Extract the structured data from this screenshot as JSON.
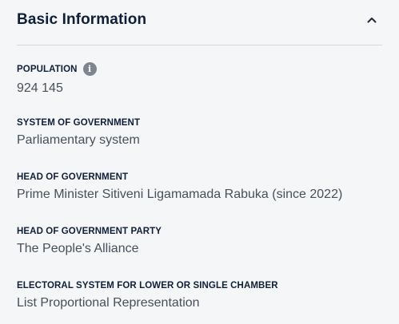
{
  "section": {
    "title": "Basic Information",
    "toggle_icon": "chevron-up-icon"
  },
  "fields": [
    {
      "label": "POPULATION",
      "value": "924 145",
      "has_info": true,
      "info_icon": "info-icon"
    },
    {
      "label": "SYSTEM OF GOVERNMENT",
      "value": "Parliamentary system"
    },
    {
      "label": "HEAD OF GOVERNMENT",
      "value": "Prime Minister Sitiveni Ligamamada Rabuka (since 2022)"
    },
    {
      "label": "HEAD OF GOVERNMENT PARTY",
      "value": "The People's Alliance"
    },
    {
      "label": "ELECTORAL SYSTEM FOR LOWER OR SINGLE CHAMBER",
      "value": "List Proportional Representation"
    }
  ]
}
